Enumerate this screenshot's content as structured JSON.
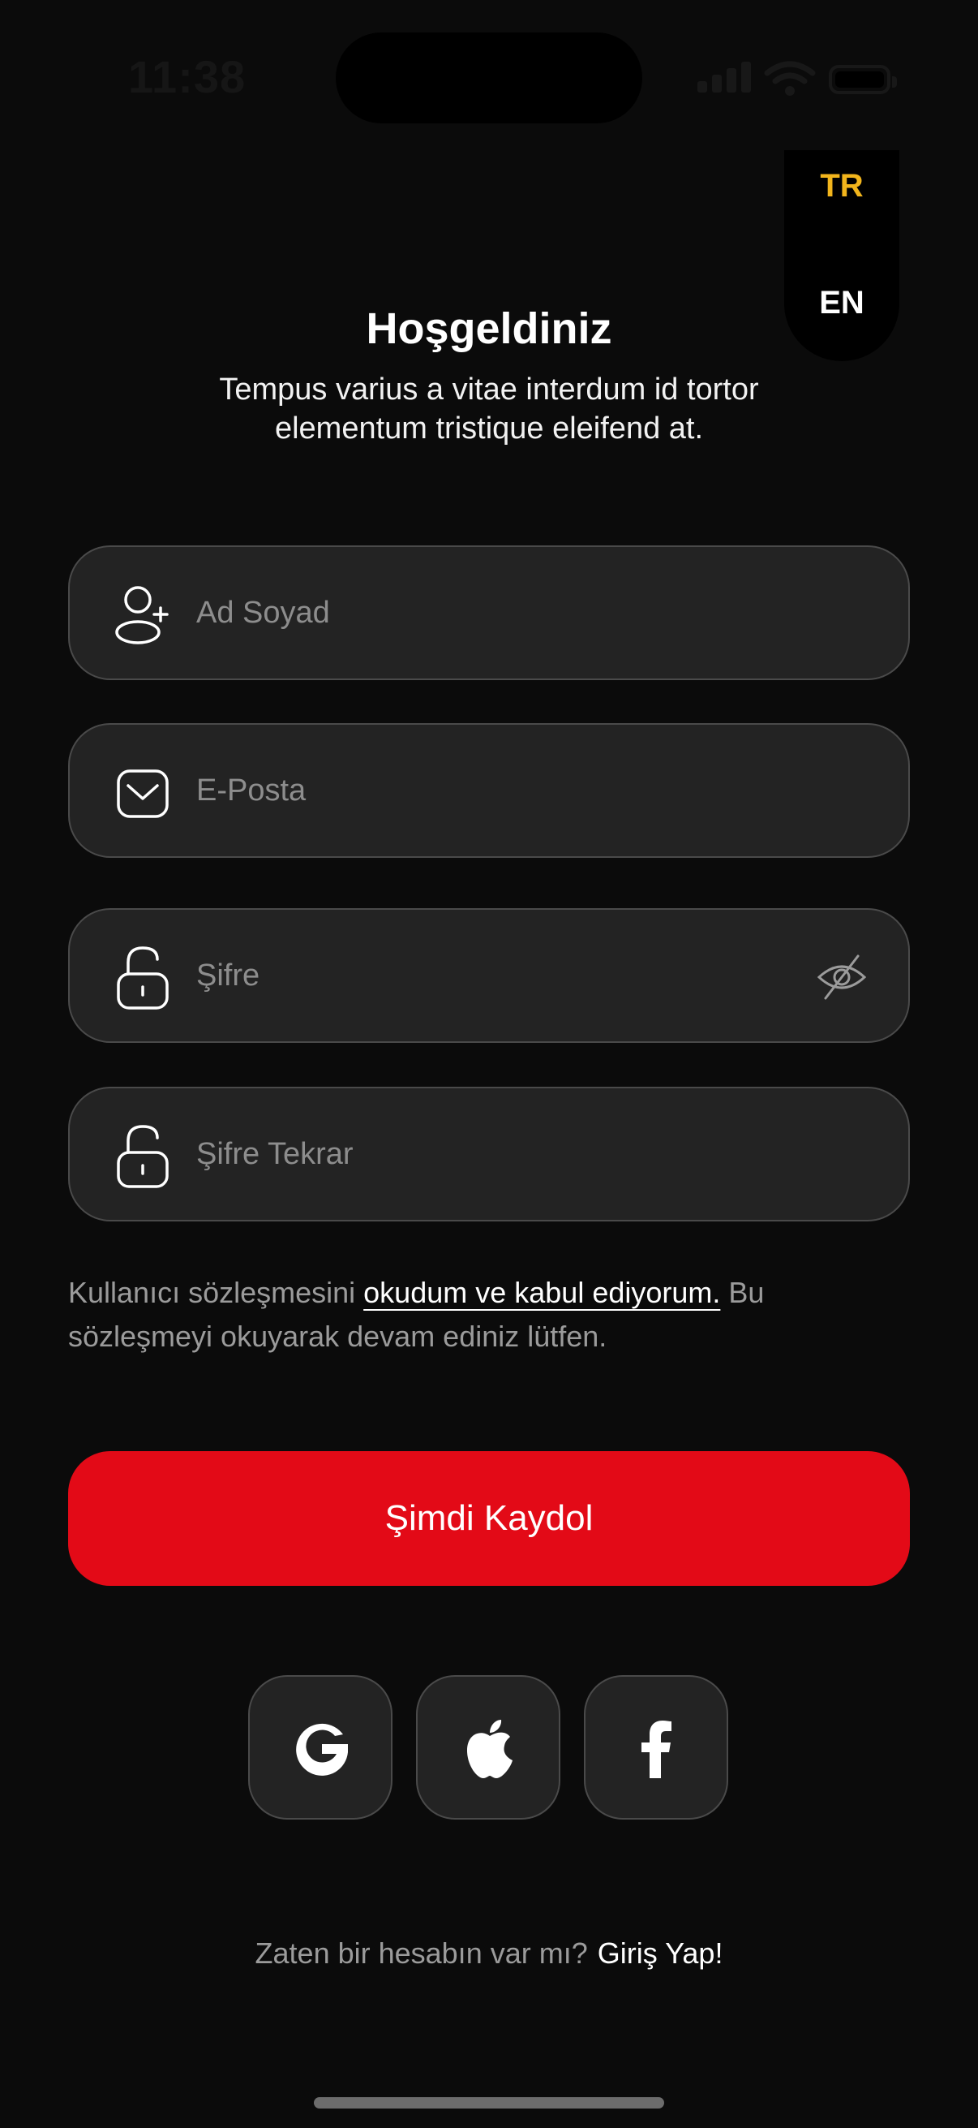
{
  "status_bar": {
    "time": "11:38"
  },
  "language": {
    "options": [
      "TR",
      "EN"
    ],
    "selected": "TR",
    "selected_color": "#f2b51c"
  },
  "header": {
    "title": "Hoşgeldiniz",
    "subtitle": "Tempus varius a vitae interdum id tortor elementum tristique eleifend at."
  },
  "form": {
    "name": {
      "placeholder": "Ad Soyad",
      "value": "",
      "icon": "add-user-icon"
    },
    "email": {
      "placeholder": "E-Posta",
      "value": "",
      "icon": "mail-icon"
    },
    "password": {
      "placeholder": "Şifre",
      "value": "",
      "icon": "lock-icon",
      "toggle_icon": "eye-off-icon"
    },
    "password_repeat": {
      "placeholder": "Şifre Tekrar",
      "value": "",
      "icon": "lock-icon"
    }
  },
  "terms": {
    "prefix": "Kullanıcı sözleşmesini ",
    "link": "okudum ve kabul ediyorum.",
    "suffix": " Bu sözleşmeyi okuyarak devam ediniz lütfen."
  },
  "cta": {
    "label": "Şimdi Kaydol",
    "color": "#e30a17"
  },
  "social": [
    "google-icon",
    "apple-icon",
    "facebook-icon"
  ],
  "footer": {
    "text": "Zaten bir hesabın var mı?",
    "link": "Giriş Yap!"
  }
}
